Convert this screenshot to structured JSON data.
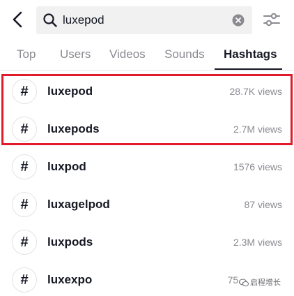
{
  "search": {
    "query": "luxepod"
  },
  "tabs": [
    {
      "label": "Top"
    },
    {
      "label": "Users"
    },
    {
      "label": "Videos"
    },
    {
      "label": "Sounds"
    },
    {
      "label": "Hashtags"
    }
  ],
  "active_tab": "Hashtags",
  "hashtags": [
    {
      "symbol": "#",
      "name": "luxepod",
      "views": "28.7K views"
    },
    {
      "symbol": "#",
      "name": "luxepods",
      "views": "2.7M views"
    },
    {
      "symbol": "#",
      "name": "luxpod",
      "views": "1576 views"
    },
    {
      "symbol": "#",
      "name": "luxagelpod",
      "views": "87 views"
    },
    {
      "symbol": "#",
      "name": "luxpods",
      "views": "2.3M views"
    },
    {
      "symbol": "#",
      "name": "luxexpo",
      "views": "75.."
    }
  ],
  "watermark": {
    "text": "启程增长"
  },
  "colors": {
    "highlight": "#e21b2c",
    "muted_text": "#8a8b91",
    "primary_text": "#161823",
    "search_bg": "#f1f1f2"
  },
  "icons": {
    "back": "chevron-left-icon",
    "search": "magnifier-icon",
    "clear": "clear-circle-icon",
    "filter": "sliders-icon",
    "hashtag": "hashtag-icon"
  }
}
